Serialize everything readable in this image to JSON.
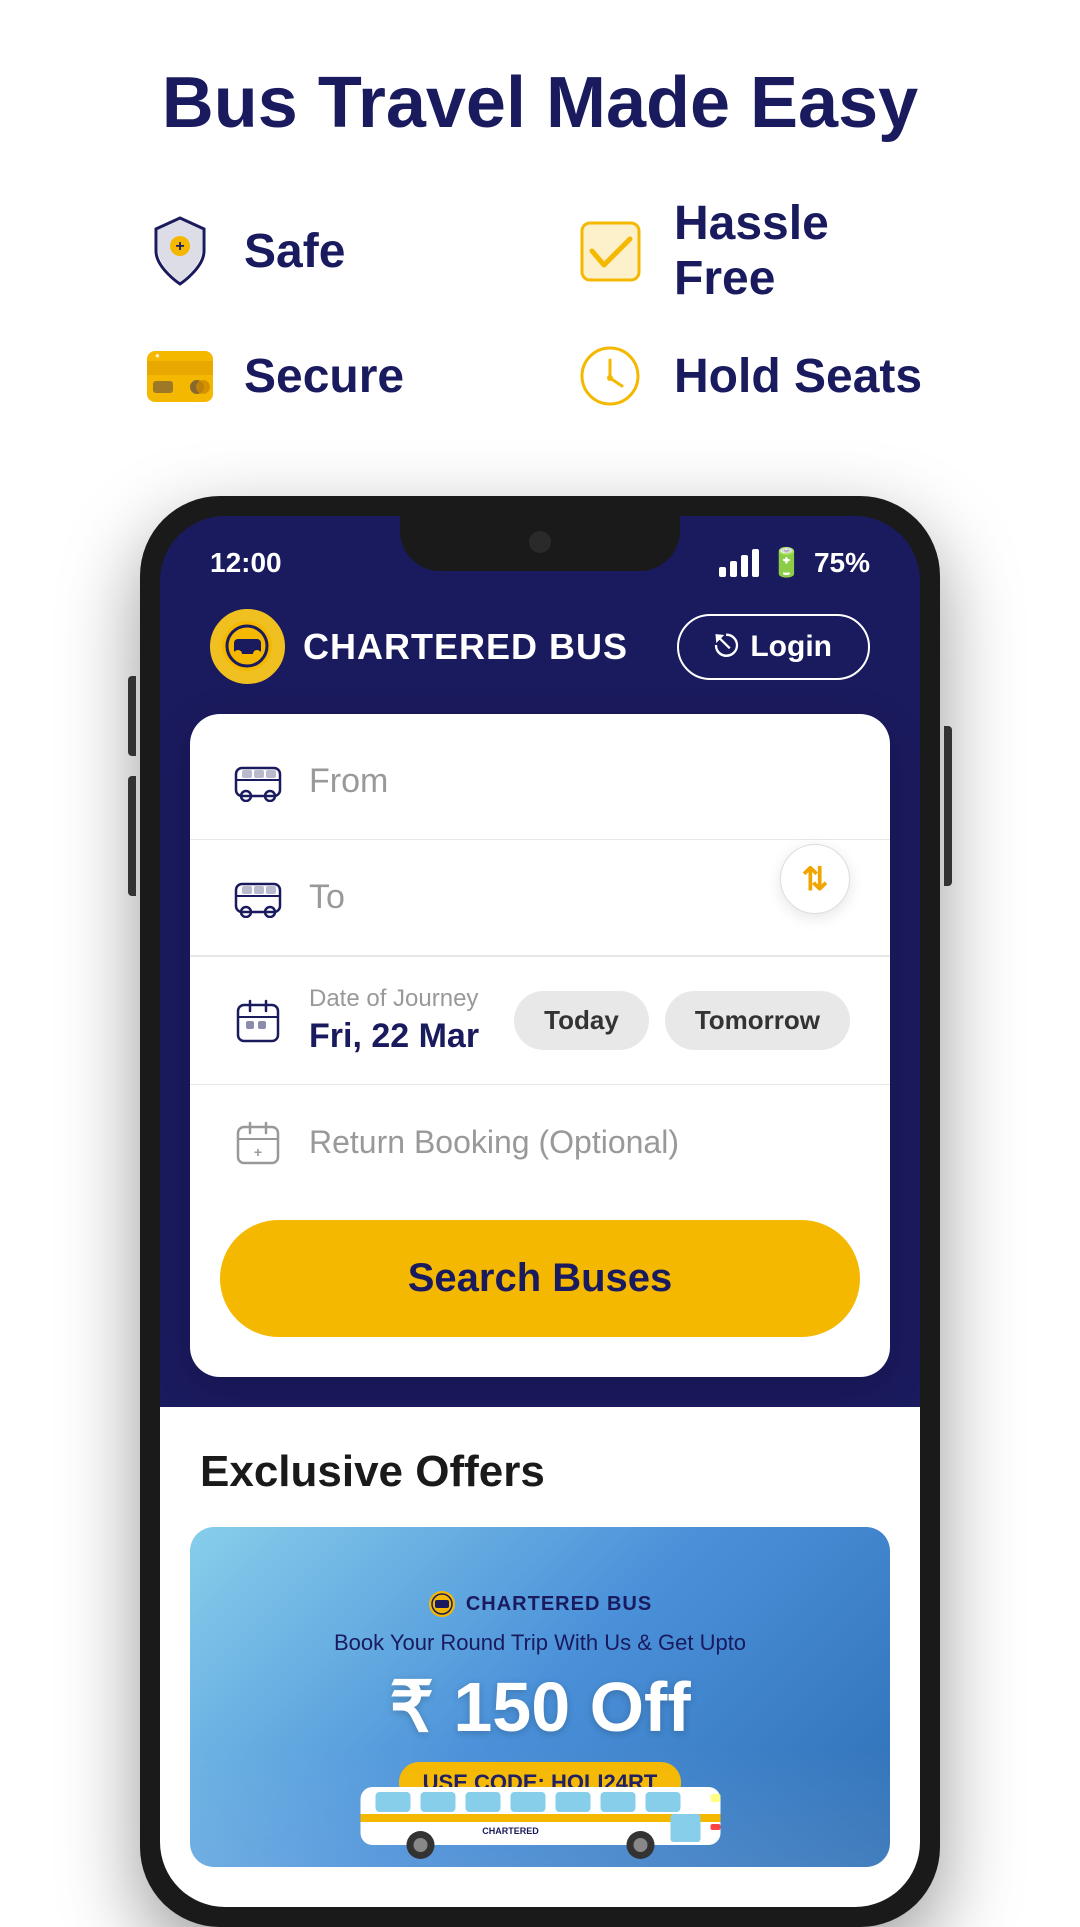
{
  "page": {
    "title": "Bus Travel Made Easy"
  },
  "features": [
    {
      "id": "safe",
      "label": "Safe",
      "icon": "shield"
    },
    {
      "id": "hassle-free",
      "label": "Hassle Free",
      "icon": "check"
    },
    {
      "id": "secure",
      "label": "Secure",
      "icon": "card"
    },
    {
      "id": "hold-seats",
      "label": "Hold Seats",
      "icon": "clock"
    }
  ],
  "status_bar": {
    "time": "12:00",
    "battery": "75%"
  },
  "navbar": {
    "logo_text": "CHARTERED BUS",
    "login_label": "Login"
  },
  "search_form": {
    "from_placeholder": "From",
    "to_placeholder": "To",
    "date_label": "Date of Journey",
    "date_value": "Fri, 22 Mar",
    "today_label": "Today",
    "tomorrow_label": "Tomorrow",
    "return_placeholder": "Return Booking (Optional)",
    "search_button": "Search Buses"
  },
  "offers": {
    "section_title": "Exclusive Offers",
    "card": {
      "logo": "CHARTERED BUS",
      "subtitle": "Book Your Round Trip With Us & Get Upto",
      "amount": "₹ 150 Off",
      "code_label": "USE CODE: HOLI24RT"
    }
  },
  "colors": {
    "navy": "#1a1a5e",
    "yellow": "#f5b800",
    "white": "#ffffff",
    "gray_text": "#999999"
  }
}
